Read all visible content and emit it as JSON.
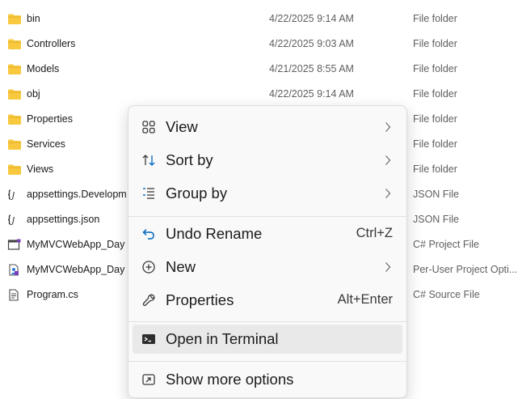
{
  "files": [
    {
      "name": "bin",
      "date": "4/22/2025 9:14 AM",
      "type": "File folder",
      "icon": "folder-icon"
    },
    {
      "name": "Controllers",
      "date": "4/22/2025 9:03 AM",
      "type": "File folder",
      "icon": "folder-icon"
    },
    {
      "name": "Models",
      "date": "4/21/2025 8:55 AM",
      "type": "File folder",
      "icon": "folder-icon"
    },
    {
      "name": "obj",
      "date": "4/22/2025 9:14 AM",
      "type": "File folder",
      "icon": "folder-icon"
    },
    {
      "name": "Properties",
      "date": "",
      "type": "File folder",
      "icon": "folder-icon"
    },
    {
      "name": "Services",
      "date": "",
      "type": "File folder",
      "icon": "folder-icon"
    },
    {
      "name": "Views",
      "date": "",
      "type": "File folder",
      "icon": "folder-icon"
    },
    {
      "name": "appsettings.Developm",
      "date": "",
      "type": "JSON File",
      "icon": "json-file-icon"
    },
    {
      "name": "appsettings.json",
      "date": "",
      "type": "JSON File",
      "icon": "json-file-icon"
    },
    {
      "name": "MyMVCWebApp_Day",
      "date": "",
      "type": "C# Project File",
      "icon": "csproj-file-icon"
    },
    {
      "name": "MyMVCWebApp_Day",
      "date": "",
      "type": "Per-User Project Opti...",
      "icon": "user-project-file-icon"
    },
    {
      "name": "Program.cs",
      "date": "",
      "type": "C# Source File",
      "icon": "cs-file-icon"
    }
  ],
  "context_menu": {
    "view": {
      "label": "View",
      "icon": "view-grid-icon"
    },
    "sort_by": {
      "label": "Sort by",
      "icon": "sort-icon"
    },
    "group_by": {
      "label": "Group by",
      "icon": "group-icon"
    },
    "undo_rename": {
      "label": "Undo Rename",
      "shortcut": "Ctrl+Z",
      "icon": "undo-icon"
    },
    "new": {
      "label": "New",
      "icon": "plus-circle-icon"
    },
    "properties": {
      "label": "Properties",
      "shortcut": "Alt+Enter",
      "icon": "wrench-icon"
    },
    "open_in_terminal": {
      "label": "Open in Terminal",
      "icon": "terminal-icon"
    },
    "show_more_options": {
      "label": "Show more options",
      "icon": "show-more-icon"
    }
  },
  "colors": {
    "folder": "#f8c93e",
    "menu_background": "#f9f9f9",
    "hover_background": "#e9e9e9",
    "undo_icon": "#0067c0"
  }
}
